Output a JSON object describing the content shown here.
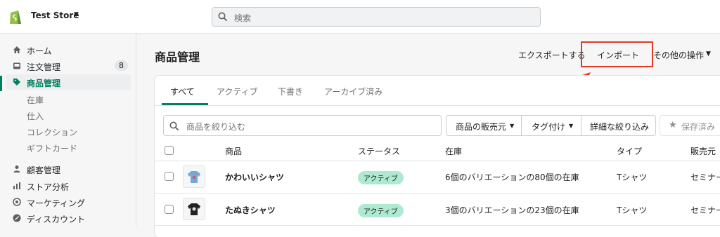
{
  "topbar": {
    "store_name": "Test Store",
    "search_placeholder": "検索"
  },
  "sidebar": {
    "items": [
      {
        "label": "ホーム",
        "icon": "home-icon"
      },
      {
        "label": "注文管理",
        "icon": "inbox-icon",
        "badge": "8"
      },
      {
        "label": "商品管理",
        "icon": "tag-icon"
      },
      {
        "label": "顧客管理",
        "icon": "person-icon"
      },
      {
        "label": "ストア分析",
        "icon": "bar-chart-icon"
      },
      {
        "label": "マーケティング",
        "icon": "target-icon"
      },
      {
        "label": "ディスカウント",
        "icon": "discount-icon"
      }
    ],
    "subitems": [
      "在庫",
      "仕入",
      "コレクション",
      "ギフトカード"
    ]
  },
  "page": {
    "title": "商品管理",
    "export_label": "エクスポートする",
    "import_label": "インポート",
    "more_actions_label": "その他の操作"
  },
  "tabs": [
    "すべて",
    "アクティブ",
    "下書き",
    "アーカイブ済み"
  ],
  "filters": {
    "search_placeholder": "商品を絞り込む",
    "vendor_label": "商品の販売元",
    "tagged_label": "タグ付け",
    "more_filters_label": "詳細な絞り込み",
    "save_label": "保存済み"
  },
  "table": {
    "headers": [
      "商品",
      "ステータス",
      "在庫",
      "タイプ",
      "販売元"
    ],
    "rows": [
      {
        "product": "かわいいシャツ",
        "status": "アクティブ",
        "inventory": "6個のバリエーションの80個の在庫",
        "type": "Tシャツ",
        "vendor": "セミナー"
      },
      {
        "product": "たぬきシャツ",
        "status": "アクティブ",
        "inventory": "3個のバリエーションの23個の在庫",
        "type": "Tシャツ",
        "vendor": "セミナー"
      }
    ]
  },
  "colors": {
    "accent": "#008060",
    "annotation": "#e03a24",
    "status_active": "#aee9d1"
  }
}
